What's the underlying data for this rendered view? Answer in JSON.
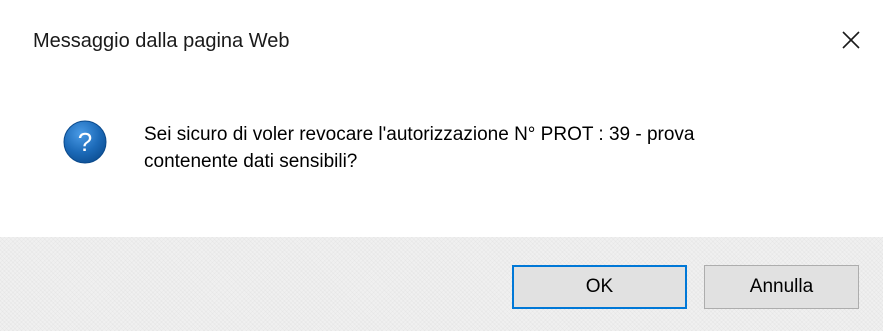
{
  "dialog": {
    "title": "Messaggio dalla pagina Web",
    "close_icon": "close-icon",
    "message_line1": "Sei sicuro di voler revocare l'autorizzazione N° PROT : 39 - prova",
    "message_line2": "contenente dati sensibili?",
    "icon": "question-icon",
    "icon_glyph": "?",
    "icon_color": "#1c6ab8",
    "ok_label": "OK",
    "cancel_label": "Annulla",
    "focus_color": "#0078d7"
  }
}
